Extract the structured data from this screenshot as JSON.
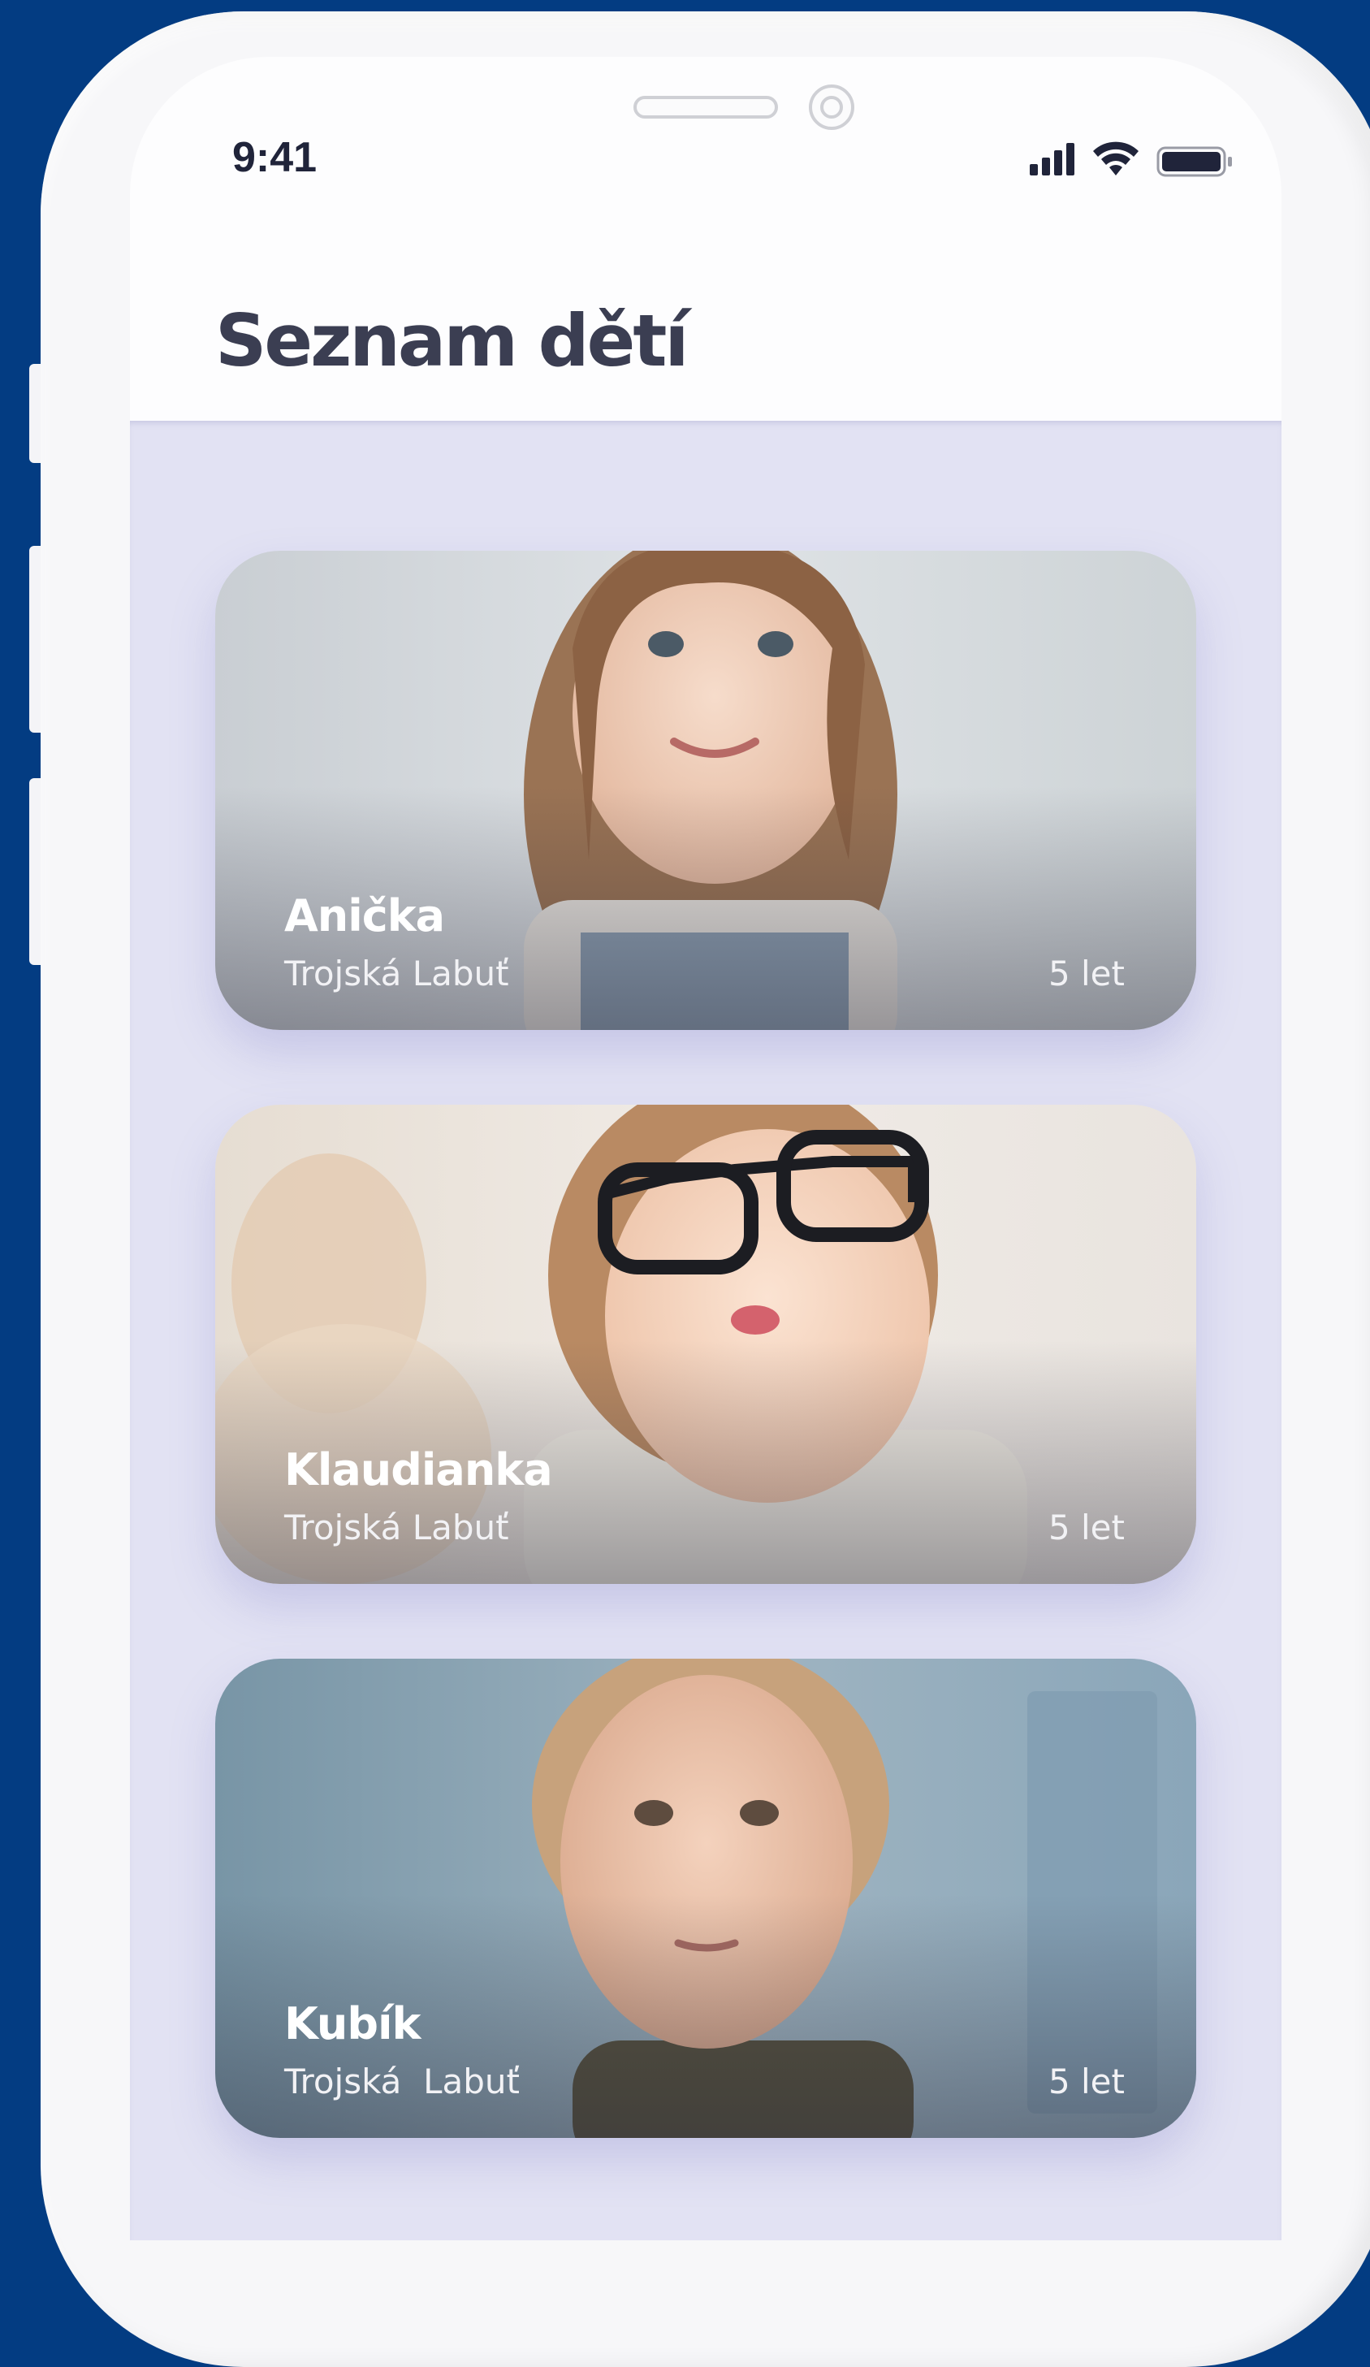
{
  "status_bar": {
    "time": "9:41",
    "icons": [
      "cellular-signal-icon",
      "wifi-icon",
      "battery-icon"
    ]
  },
  "header": {
    "title": "Seznam dětí"
  },
  "children": [
    {
      "name": "Anička",
      "place": "Trojská Labuť",
      "age": "5 let"
    },
    {
      "name": "Klaudianka",
      "place": "Trojská Labuť",
      "age": "5 let"
    },
    {
      "name": "Kubík",
      "place": "Trojská  Labuť",
      "age": "5 let"
    }
  ],
  "colors": {
    "background": "#033c82",
    "list_background": "#e2e2f3",
    "title": "#3b3e52"
  }
}
